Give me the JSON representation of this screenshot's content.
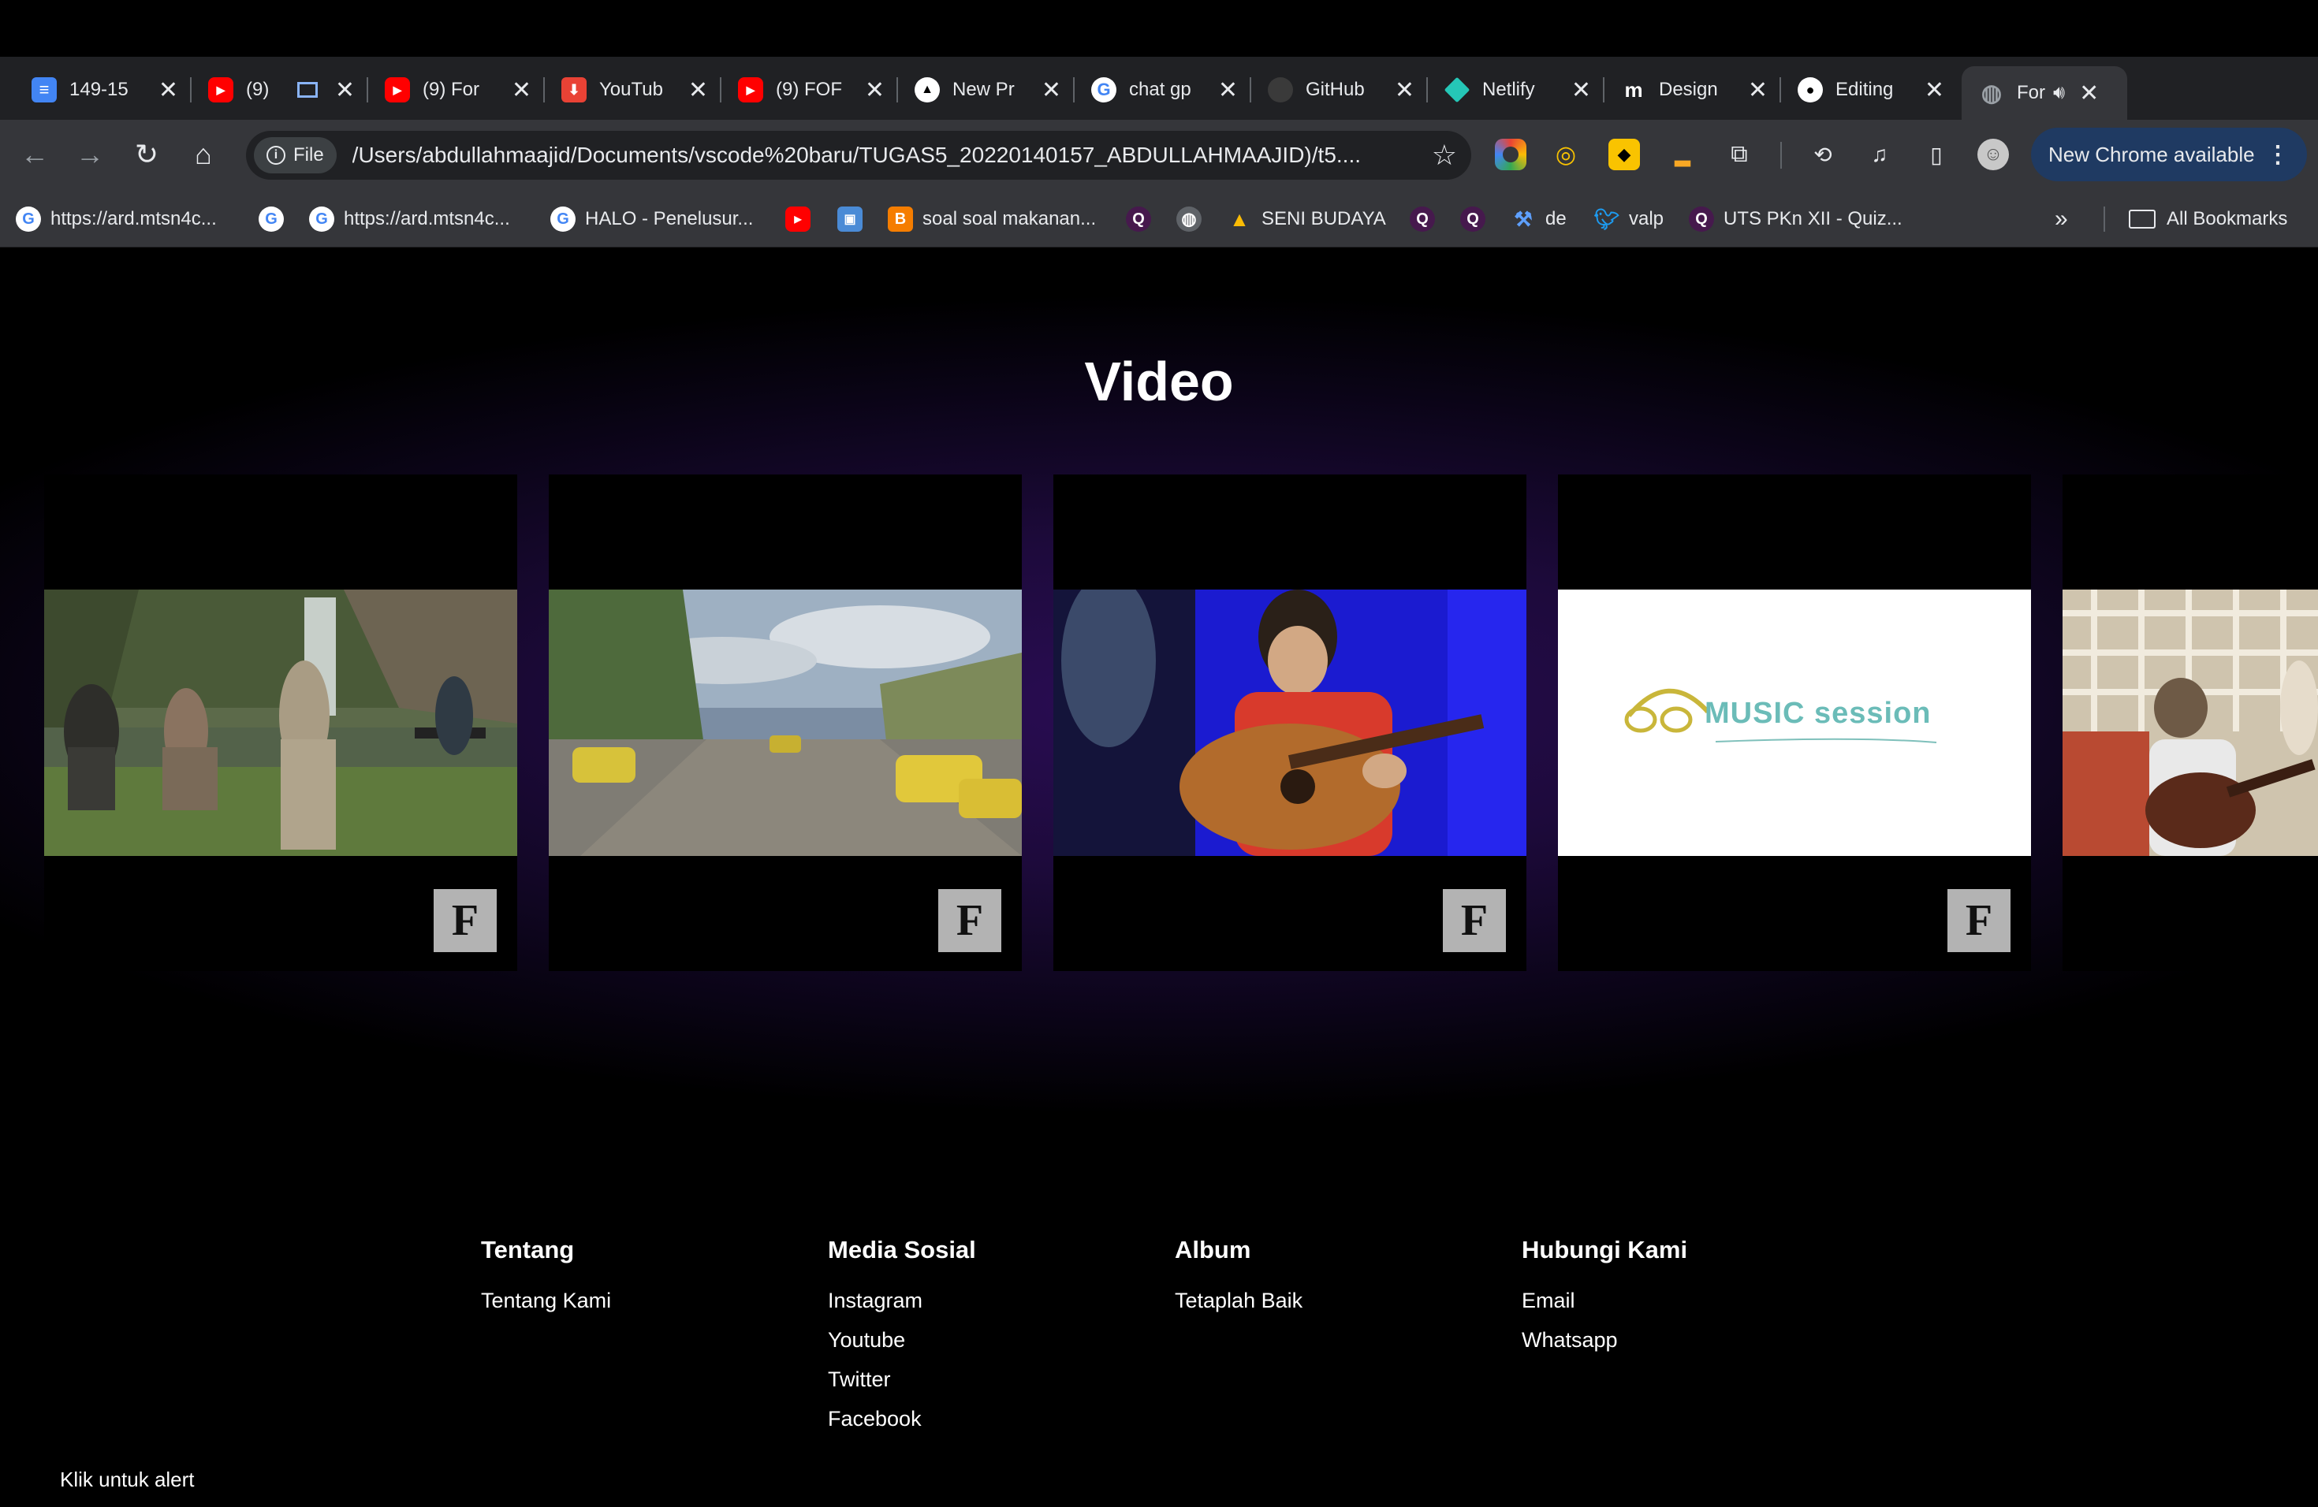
{
  "browser": {
    "tabs": [
      {
        "title": "149-15",
        "icon": "docs-icon",
        "color": "#4285f4"
      },
      {
        "title": "(9)",
        "icon": "youtube-icon",
        "color": "#ff0000"
      },
      {
        "title": "(9) For",
        "icon": "youtube-icon",
        "color": "#ff0000"
      },
      {
        "title": "YouTub",
        "icon": "download-icon",
        "color": "#e94235"
      },
      {
        "title": "(9) FOF",
        "icon": "youtube-icon",
        "color": "#ff0000"
      },
      {
        "title": "New Pr",
        "icon": "vercel-icon",
        "color": "#ffffff"
      },
      {
        "title": "chat gp",
        "icon": "google-icon",
        "color": "#ffffff"
      },
      {
        "title": "GitHub",
        "icon": "github-icon",
        "color": "#3a3a3a"
      },
      {
        "title": "Netlify",
        "icon": "netlify-icon",
        "color": "#25c7b7"
      },
      {
        "title": "Design",
        "icon": "mobbin-icon",
        "color": "#ffffff"
      },
      {
        "title": "Editing",
        "icon": "github-icon",
        "color": "#ffffff"
      },
      {
        "title": "For",
        "icon": "globe-icon",
        "color": "#9aa0a6"
      }
    ],
    "address": {
      "chip": "File",
      "url": "/Users/abdullahmaajid/Documents/vscode%20baru/TUGAS5_20220140157_ABDULLAHMAAJID)/t5...."
    },
    "update_button": "New Chrome available",
    "bookmarks": [
      {
        "label": "https://ard.mtsn4c...",
        "icon": "google-icon"
      },
      {
        "label": "",
        "icon": "google-icon"
      },
      {
        "label": "https://ard.mtsn4c...",
        "icon": "google-icon"
      },
      {
        "label": "HALO - Penelusur...",
        "icon": "google-icon"
      },
      {
        "label": "",
        "icon": "youtube-icon"
      },
      {
        "label": "",
        "icon": "app-icon"
      },
      {
        "label": "soal soal makanan...",
        "icon": "blogger-icon"
      },
      {
        "label": "",
        "icon": "quizizz-icon"
      },
      {
        "label": "",
        "icon": "globe-icon"
      },
      {
        "label": "SENI BUDAYA",
        "icon": "drive-icon"
      },
      {
        "label": "",
        "icon": "quizizz-icon"
      },
      {
        "label": "",
        "icon": "quizizz-icon"
      },
      {
        "label": "de",
        "icon": "tools-icon"
      },
      {
        "label": "valp",
        "icon": "twitter-icon"
      },
      {
        "label": "UTS PKn XII - Quiz...",
        "icon": "quizizz-icon"
      }
    ],
    "all_bookmarks": "All Bookmarks"
  },
  "page": {
    "section_title": "Video",
    "videos": [
      {
        "name": "video-1",
        "thumb_text": ""
      },
      {
        "name": "video-2",
        "thumb_text": ""
      },
      {
        "name": "video-3",
        "thumb_text": ""
      },
      {
        "name": "video-4",
        "thumb_text": "MUSIC session"
      },
      {
        "name": "video-5",
        "thumb_text": ""
      }
    ],
    "badge": "F"
  },
  "footer": {
    "columns": [
      {
        "title": "Tentang",
        "links": [
          "Tentang Kami"
        ]
      },
      {
        "title": "Media Sosial",
        "links": [
          "Instagram",
          "Youtube",
          "Twitter",
          "Facebook"
        ]
      },
      {
        "title": "Album",
        "links": [
          "Tetaplah Baik"
        ]
      },
      {
        "title": "Hubungi Kami",
        "links": [
          "Email",
          "Whatsapp"
        ]
      }
    ],
    "alert_text": "Klik untuk alert"
  }
}
